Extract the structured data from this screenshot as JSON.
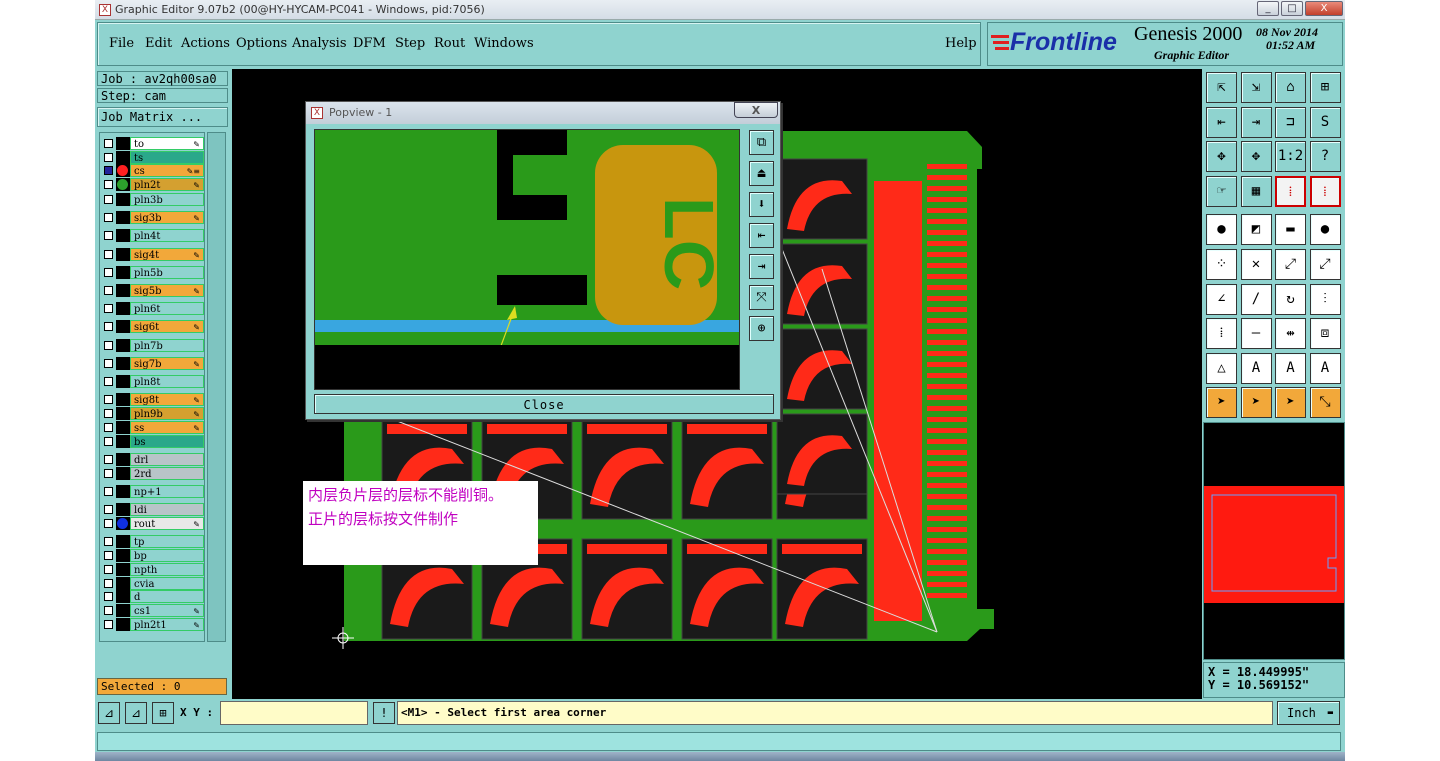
{
  "window": {
    "title": "Graphic Editor 9.07b2 (00@HY-HYCAM-PC041 - Windows, pid:7056)",
    "controls": [
      "_",
      "□",
      "X"
    ]
  },
  "menu": [
    "File",
    "Edit",
    "Actions",
    "Options",
    "Analysis",
    "DFM",
    "Step",
    "Rout",
    "Windows"
  ],
  "help": "Help",
  "brand": {
    "logo": "Frontline",
    "product": "Genesis 2000",
    "subtitle": "Graphic Editor",
    "date": "08 Nov 2014",
    "time": "01:52 AM"
  },
  "job": {
    "job_label": "Job : av2qh00sa0",
    "step_label": "Step: cam",
    "matrix_button": "Job Matrix ..."
  },
  "layers": [
    {
      "name": "to",
      "color": "#ffffff",
      "edit": true
    },
    {
      "name": "ts",
      "color": "#2aa88a",
      "edit": false
    },
    {
      "name": "cs",
      "color": "#f2a83a",
      "edit": true,
      "selected": true,
      "dot": "#ff2020",
      "extra": "≡"
    },
    {
      "name": "pln2t",
      "color": "#d4a030",
      "edit": true,
      "dot": "#2ca02c"
    },
    {
      "name": "pln3b",
      "color": "#8fd3cf",
      "edit": false
    },
    {
      "name": "sig3b",
      "color": "#f2a83a",
      "edit": true
    },
    {
      "name": "pln4t",
      "color": "#8fd3cf",
      "edit": false
    },
    {
      "name": "sig4t",
      "color": "#f2a83a",
      "edit": true
    },
    {
      "name": "pln5b",
      "color": "#8fd3cf",
      "edit": false
    },
    {
      "name": "sig5b",
      "color": "#f2a83a",
      "edit": true
    },
    {
      "name": "pln6t",
      "color": "#8fd3cf",
      "edit": false
    },
    {
      "name": "sig6t",
      "color": "#f2a83a",
      "edit": true
    },
    {
      "name": "pln7b",
      "color": "#8fd3cf",
      "edit": false
    },
    {
      "name": "sig7b",
      "color": "#f2a83a",
      "edit": true
    },
    {
      "name": "pln8t",
      "color": "#8fd3cf",
      "edit": false
    },
    {
      "name": "sig8t",
      "color": "#f2a83a",
      "edit": true
    },
    {
      "name": "pln9b",
      "color": "#d4a030",
      "edit": true
    },
    {
      "name": "ss",
      "color": "#f2a83a",
      "edit": true
    },
    {
      "name": "bs",
      "color": "#2aa88a",
      "edit": false
    },
    {
      "name": "drl",
      "color": "#b8c4c8",
      "edit": false
    },
    {
      "name": "2rd",
      "color": "#b8c4c8",
      "edit": false
    },
    {
      "name": "np+1",
      "color": "#8fd3cf",
      "edit": false
    },
    {
      "name": "ldi",
      "color": "#b8c4c8",
      "edit": false
    },
    {
      "name": "rout",
      "color": "#e8e8e8",
      "edit": true,
      "dot": "#1030e0"
    },
    {
      "name": "tp",
      "color": "#8fd3cf",
      "edit": false
    },
    {
      "name": "bp",
      "color": "#8fd3cf",
      "edit": false
    },
    {
      "name": "npth",
      "color": "#8fd3cf",
      "edit": false
    },
    {
      "name": "cvia",
      "color": "#8fd3cf",
      "edit": false
    },
    {
      "name": "d",
      "color": "#8fd3cf",
      "edit": false
    },
    {
      "name": "cs1",
      "color": "#8fd3cf",
      "edit": true
    },
    {
      "name": "pln2t1",
      "color": "#8fd3cf",
      "edit": true
    }
  ],
  "popview": {
    "title": "Popview - 1",
    "close_x": "X",
    "close_button": "Close",
    "glyphs": [
      "⧉",
      "⏏",
      "⬇",
      "⇤",
      "⇥",
      "⤧",
      "⊕"
    ]
  },
  "note": {
    "line1": "内层负片层的层标不能削铜。",
    "line2": "正片的层标按文件制作"
  },
  "selected_label": "Selected : 0",
  "xy_label": "X Y :",
  "prompt": "<M1> - Select first area corner",
  "units": "Inch",
  "coords": {
    "x": "X = 18.449995\"",
    "y": "Y = 10.569152\""
  },
  "tools": [
    [
      "⇱",
      "⇲",
      "⌂",
      "⊞"
    ],
    [
      "⇤",
      "⇥",
      "⊐",
      "S"
    ],
    [
      "✥",
      "✥",
      "1:2",
      "?"
    ],
    [
      "☞",
      "▦",
      "⁞",
      "⁞"
    ],
    [
      "●",
      "◩",
      "▬",
      "●"
    ],
    [
      "⁘",
      "✕",
      "⤢",
      "⤢"
    ],
    [
      "∠",
      "/",
      "↻",
      "⫶"
    ],
    [
      "⁞",
      "—",
      "⇹",
      "⧈"
    ],
    [
      "△",
      "A",
      "A",
      "A"
    ],
    [
      "➤",
      "➤",
      "➤",
      "⤡"
    ]
  ],
  "colors": {
    "panel": "#8fd3cf",
    "highlight": "#f2a83a",
    "board_green": "#2a9a1a",
    "copper_red": "#ff2a18"
  }
}
